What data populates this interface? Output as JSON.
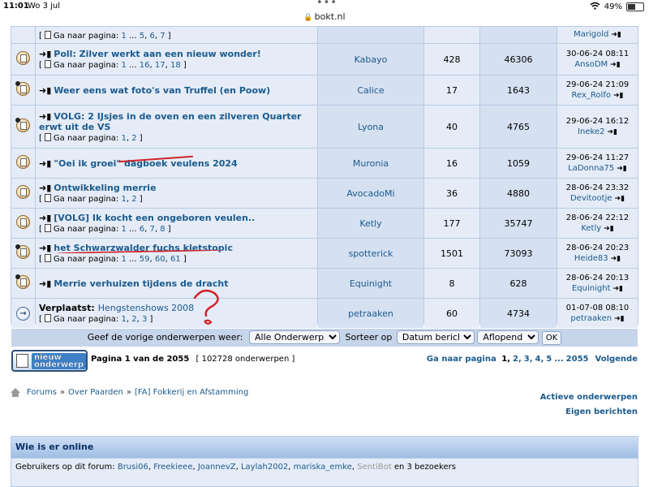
{
  "status_bar": {
    "time": "11:01",
    "date": "Wo 3 jul",
    "battery": "49%",
    "battery_level": 0.49
  },
  "url": "bokt.nl",
  "topics": [
    {
      "title": "",
      "pages_prefix": "Ga naar pagina:",
      "pages": [
        "1",
        "...",
        "5",
        "6",
        "7"
      ],
      "author": "",
      "replies": "",
      "views": "",
      "last_date": "",
      "last_user": "Marigold",
      "partial": true
    },
    {
      "title": "Poll: Zilver werkt aan een nieuw wonder!",
      "pages_prefix": "Ga naar pagina:",
      "pages": [
        "1",
        "...",
        "16",
        "17",
        "18"
      ],
      "author": "Kabayo",
      "replies": "428",
      "views": "46306",
      "last_date": "30-06-24 08:11",
      "last_user": "AnsoDM"
    },
    {
      "title": "Weer eens wat foto's van Truffel (en Poow)",
      "pages_prefix": "",
      "pages": [],
      "author": "Calice",
      "replies": "17",
      "views": "1643",
      "last_date": "29-06-24 21:09",
      "last_user": "Rex_Rolfo"
    },
    {
      "title": "VOLG: 2 IJsjes in de oven en een zilveren Quarter erwt uit de VS",
      "pages_prefix": "Ga naar pagina:",
      "pages": [
        "1",
        "2"
      ],
      "author": "Lyona",
      "replies": "40",
      "views": "4765",
      "last_date": "29-06-24 16:12",
      "last_user": "Ineke2"
    },
    {
      "title": "\"Oei ik groei\" dagboek veulens 2024",
      "pages_prefix": "",
      "pages": [],
      "author": "Muronia",
      "replies": "16",
      "views": "1059",
      "last_date": "29-06-24 11:27",
      "last_user": "LaDonna75"
    },
    {
      "title": "Ontwikkeling merrie",
      "pages_prefix": "Ga naar pagina:",
      "pages": [
        "1",
        "2"
      ],
      "author": "AvocadoMi",
      "replies": "36",
      "views": "4880",
      "last_date": "28-06-24 23:32",
      "last_user": "Devitootje"
    },
    {
      "title": "[VOLG] Ik kocht een ongeboren veulen..",
      "pages_prefix": "Ga naar pagina:",
      "pages": [
        "1",
        "...",
        "6",
        "7",
        "8"
      ],
      "author": "Ketly",
      "replies": "177",
      "views": "35747",
      "last_date": "28-06-24 22:12",
      "last_user": "Ketly"
    },
    {
      "title": "het Schwarzwalder fuchs kletstopic",
      "pages_prefix": "Ga naar pagina:",
      "pages": [
        "1",
        "...",
        "59",
        "60",
        "61"
      ],
      "author": "spotterick",
      "replies": "1501",
      "views": "73093",
      "last_date": "28-06-24 20:23",
      "last_user": "Heide83"
    },
    {
      "title": "Merrie verhuizen tijdens de dracht",
      "pages_prefix": "",
      "pages": [],
      "author": "Equinight",
      "replies": "8",
      "views": "628",
      "last_date": "28-06-24 20:13",
      "last_user": "Equinight"
    },
    {
      "moved_prefix": "Verplaatst:",
      "title": "Hengstenshows 2008",
      "pages_prefix": "Ga naar pagina:",
      "pages": [
        "1",
        "2",
        "3"
      ],
      "author": "petraaken",
      "replies": "60",
      "views": "4734",
      "last_date": "01-07-08 08:10",
      "last_user": "petraaken",
      "moved": true
    }
  ],
  "filter": {
    "label": "Geef de vorige onderwerpen weer:",
    "period": "Alle Onderwerpen",
    "sort_label": "Sorteer op",
    "sort_by": "Datum bericht",
    "order": "Aflopend",
    "ok": "OK"
  },
  "new_topic": {
    "line1": "nieuw",
    "line2": "onderwerp"
  },
  "pagination": {
    "page_info": "Pagina 1 van de 2055",
    "topic_count": "[ 102728 onderwerpen ]",
    "goto_label": "Ga naar pagina",
    "pages": [
      "1",
      "2",
      "3",
      "4",
      "5",
      "...",
      "2055"
    ],
    "next": "Volgende"
  },
  "breadcrumb": [
    "Forums",
    "Over Paarden",
    "[FA] Fokkerij en Afstamming"
  ],
  "links": {
    "active": "Actieve onderwerpen",
    "own": "Eigen berichten"
  },
  "online": {
    "title": "Wie is er online",
    "prefix": "Gebruikers op dit forum:",
    "users": [
      "Brusi06",
      "Freekieee",
      "JoannevZ",
      "Laylah2002",
      "mariska_emke"
    ],
    "bot": "SentiBot",
    "suffix": "en 3 bezoekers"
  },
  "annotations": {
    "mark_color": "#d2232a",
    "question": "?"
  }
}
